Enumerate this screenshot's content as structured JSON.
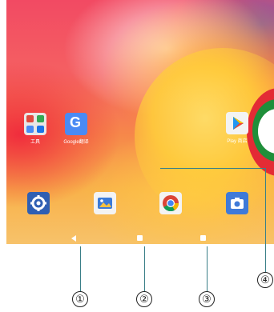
{
  "home_screen": {
    "folder_label": "工具",
    "translate_label": "Google翻译",
    "translate_glyph": "G",
    "playstore_label": "Play 商店"
  },
  "dock": {
    "icons": [
      "settings-icon",
      "gallery-icon",
      "chrome-icon",
      "camera-icon"
    ]
  },
  "callouts": {
    "m1": "①",
    "m2": "②",
    "m3": "③",
    "m4": "④"
  },
  "colors": {
    "callout_line": "#3a7f88",
    "settings": "#2f5fb3",
    "translate": "#4a8af4",
    "camera": "#3f7ad8"
  }
}
